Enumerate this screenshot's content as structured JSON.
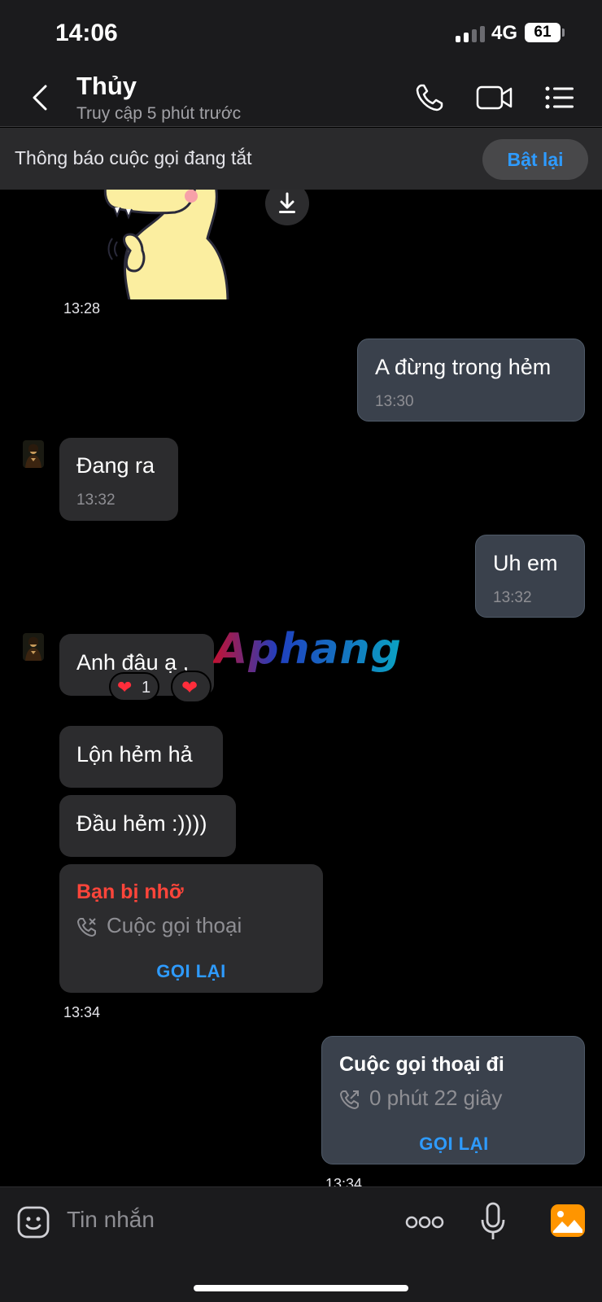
{
  "status_bar": {
    "time": "14:06",
    "network": "4G",
    "battery": "61"
  },
  "header": {
    "name": "Thủy",
    "status": "Truy cập 5 phút trước"
  },
  "banner": {
    "text": "Thông báo cuộc gọi đang tắt",
    "button": "Bật lại"
  },
  "chat": {
    "sticker_time": "13:28",
    "messages": [
      {
        "text": "A đừng trong hẻm",
        "time": "13:30"
      },
      {
        "text": "Đang ra",
        "time": "13:32"
      },
      {
        "text": "Uh em",
        "time": "13:32"
      },
      {
        "text": "Anh đâu ạ ,",
        "reaction_count": "1"
      },
      {
        "text": "Lộn hẻm hả"
      },
      {
        "text": "Đầu hẻm :))))"
      }
    ],
    "missed_call": {
      "title": "Bạn bị nhỡ",
      "subtitle": "Cuộc gọi thoại",
      "button": "GỌI LẠI",
      "time": "13:34"
    },
    "outgoing_call": {
      "title": "Cuộc gọi thoại đi",
      "subtitle": "0 phút 22 giây",
      "button": "GỌI LẠI",
      "time": "13:34"
    }
  },
  "watermark": "Aphang",
  "input": {
    "placeholder": "Tin nhắn"
  },
  "icons": {
    "back": "chevron-left-icon",
    "call": "phone-icon",
    "video": "video-icon",
    "menu": "list-icon",
    "download": "download-icon",
    "emoji": "sticker-icon",
    "more": "more-dots-icon",
    "mic": "microphone-icon",
    "gallery": "image-icon"
  },
  "colors": {
    "accent": "#2e9bff",
    "missed": "#ff453a",
    "gallery": "#ff9500"
  }
}
